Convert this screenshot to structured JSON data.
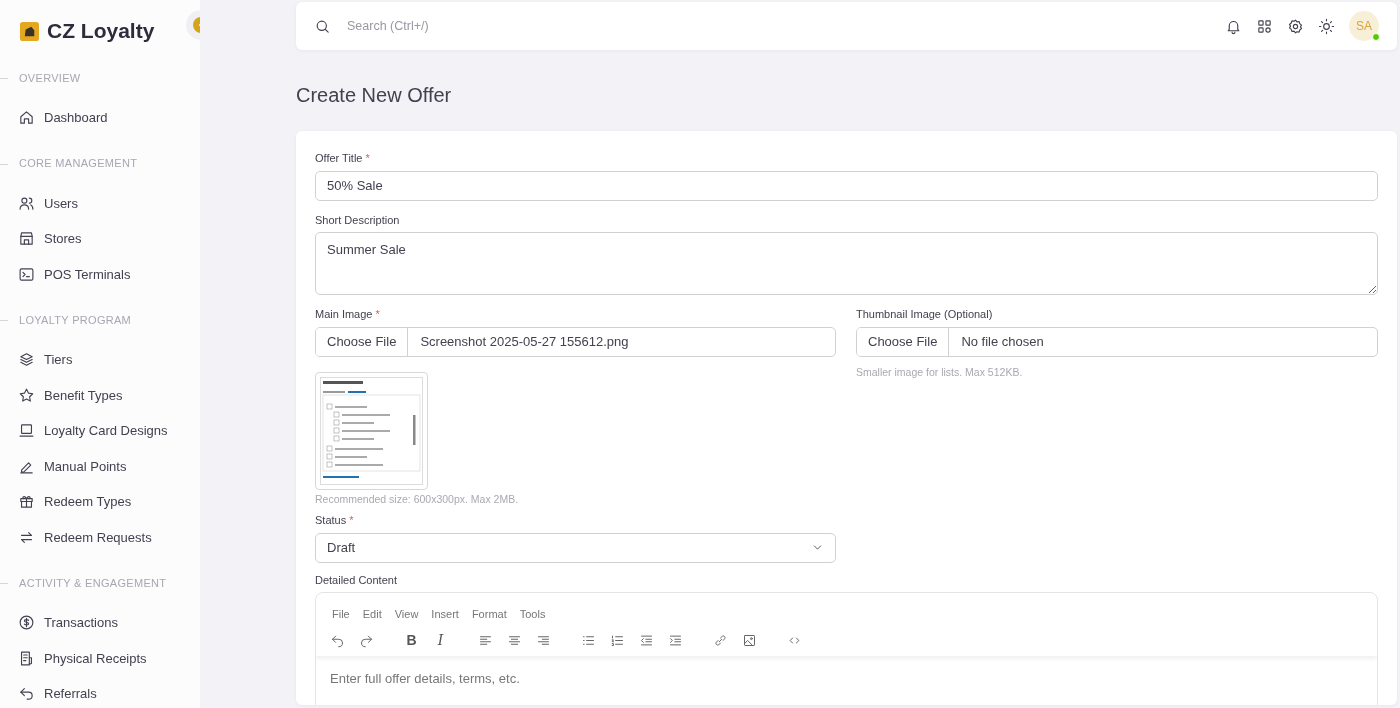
{
  "brand": {
    "name": "CZ Loyalty"
  },
  "sidebar": {
    "sections": [
      {
        "title": "OVERVIEW",
        "items": [
          {
            "label": "Dashboard"
          }
        ]
      },
      {
        "title": "CORE MANAGEMENT",
        "items": [
          {
            "label": "Users"
          },
          {
            "label": "Stores"
          },
          {
            "label": "POS Terminals"
          }
        ]
      },
      {
        "title": "LOYALTY PROGRAM",
        "items": [
          {
            "label": "Tiers"
          },
          {
            "label": "Benefit Types"
          },
          {
            "label": "Loyalty Card Designs"
          },
          {
            "label": "Manual Points"
          },
          {
            "label": "Redeem Types"
          },
          {
            "label": "Redeem Requests"
          }
        ]
      },
      {
        "title": "ACTIVITY & ENGAGEMENT",
        "items": [
          {
            "label": "Transactions"
          },
          {
            "label": "Physical Receipts"
          },
          {
            "label": "Referrals"
          }
        ]
      }
    ]
  },
  "topbar": {
    "search_placeholder": "Search (Ctrl+/)",
    "avatar": {
      "initials": "SA",
      "online": true
    }
  },
  "page_title": "Create New Offer",
  "form": {
    "offer_title": {
      "label": "Offer Title",
      "required": "*",
      "value": "50% Sale"
    },
    "short_description": {
      "label": "Short Description",
      "value": "Summer Sale"
    },
    "main_image": {
      "label": "Main Image",
      "required": "*",
      "button": "Choose File",
      "file": "Screenshot 2025-05-27 155612.png",
      "help": "Recommended size: 600x300px. Max 2MB."
    },
    "thumbnail_image": {
      "label": "Thumbnail Image (Optional)",
      "button": "Choose File",
      "file": "No file chosen",
      "help": "Smaller image for lists. Max 512KB."
    },
    "status": {
      "label": "Status",
      "required": "*",
      "value": "Draft"
    },
    "detailed_content": {
      "label": "Detailed Content",
      "menu": [
        "File",
        "Edit",
        "View",
        "Insert",
        "Format",
        "Tools"
      ],
      "toolbar": [
        [
          {
            "kind": "icon"
          },
          {
            "kind": "icon"
          }
        ],
        [
          {
            "kind": "bold",
            "label": "B"
          },
          {
            "kind": "italic",
            "label": "I"
          }
        ],
        [
          {
            "kind": "icon"
          },
          {
            "kind": "icon"
          },
          {
            "kind": "icon"
          }
        ],
        [
          {
            "kind": "icon"
          },
          {
            "kind": "icon"
          },
          {
            "kind": "icon"
          },
          {
            "kind": "icon"
          }
        ],
        [
          {
            "kind": "icon"
          },
          {
            "kind": "icon"
          }
        ],
        [
          {
            "kind": "icon"
          }
        ]
      ],
      "placeholder": "Enter full offer details, terms, etc."
    }
  }
}
